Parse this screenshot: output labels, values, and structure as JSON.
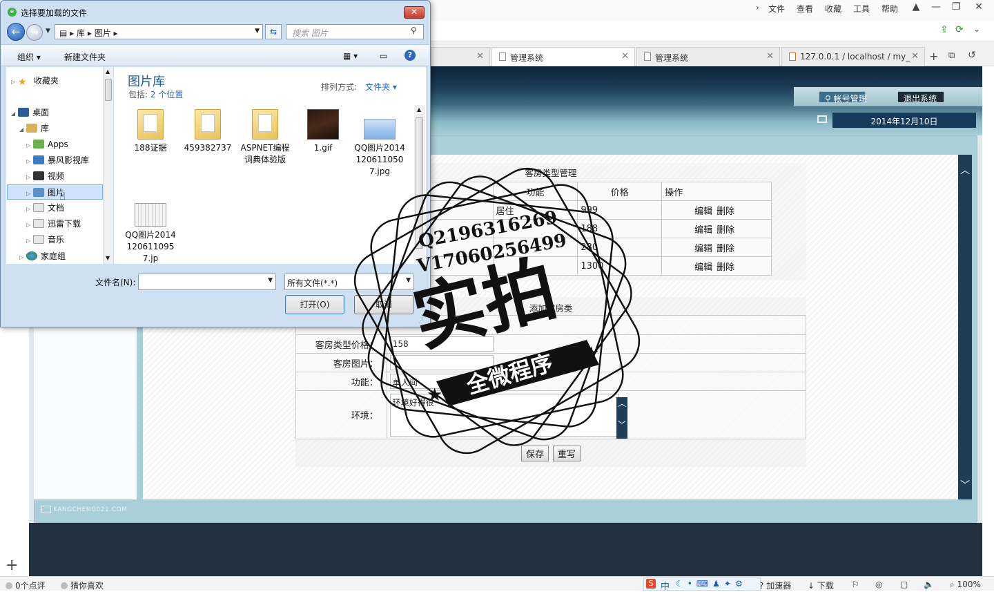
{
  "browser": {
    "menu": [
      "文件",
      "查看",
      "收藏",
      "工具",
      "帮助"
    ],
    "tabs": [
      {
        "label": ""
      },
      {
        "label": "管理系统"
      },
      {
        "label": "管理系统"
      },
      {
        "label": "127.0.0.1 / localhost / my_"
      }
    ],
    "status": {
      "comments": "0个点评",
      "recommend": "猜你喜欢",
      "accelerator": "加速器",
      "download": "下载",
      "zoom": "100%",
      "ime_mode": "中"
    }
  },
  "page": {
    "header": {
      "account_button": "帐号管理",
      "logout_button": "退出系统",
      "date": "2014年12月10日"
    },
    "room_types": {
      "title": "客房类型管理",
      "columns": [
        "",
        "功能",
        "价格",
        "操作"
      ],
      "rows": [
        {
          "name": "",
          "function": "居住",
          "price": "999"
        },
        {
          "name": "",
          "function": "",
          "price": "188"
        },
        {
          "name": "",
          "function": "",
          "price": "280"
        },
        {
          "name": "",
          "function": "",
          "price": "1300"
        }
      ],
      "edit_label": "编辑",
      "delete_label": "删除"
    },
    "form": {
      "title": "添加客房类",
      "price_label": "客房类型价格：",
      "price_value": "158",
      "image_label": "客房图片：",
      "function_label": "功能：",
      "function_value": "单人间",
      "environment_label": "环境：",
      "environment_value": "环境好得很",
      "save_button": "保存",
      "reset_button": "重写"
    },
    "footer_logo": "KANGCHENG021.COM"
  },
  "dialog": {
    "title": "选择要加载的文件",
    "path": [
      "库",
      "图片"
    ],
    "search_placeholder": "搜索 图片",
    "toolbar": {
      "organize": "组织",
      "new_folder": "新建文件夹"
    },
    "nav": [
      {
        "label": "收藏夹",
        "icon": "star-icon"
      },
      {
        "label": "桌面",
        "icon": "desktop-icon"
      },
      {
        "label": "库",
        "icon": "library-icon"
      },
      {
        "label": "Apps",
        "icon": "apps-icon"
      },
      {
        "label": "暴风影视库",
        "icon": "video-library-icon"
      },
      {
        "label": "视频",
        "icon": "video-icon"
      },
      {
        "label": "图片",
        "icon": "picture-icon"
      },
      {
        "label": "文档",
        "icon": "document-icon"
      },
      {
        "label": "迅雷下载",
        "icon": "download-icon"
      },
      {
        "label": "音乐",
        "icon": "music-icon"
      },
      {
        "label": "家庭组",
        "icon": "homegroup-icon"
      }
    ],
    "library_title": "图片库",
    "library_includes": "包括:",
    "library_locations": "2 个位置",
    "sort_label": "排列方式:",
    "sort_value": "文件夹",
    "files": [
      {
        "name": "188证据",
        "kind": "folder"
      },
      {
        "name": "459382737",
        "kind": "folder"
      },
      {
        "name": "ASPNET编程词典体验版",
        "kind": "folder"
      },
      {
        "name": "1.gif",
        "kind": "image"
      },
      {
        "name": "QQ图片20141206110507.jpg",
        "kind": "image"
      },
      {
        "name": "QQ图片20141206110957.jp",
        "kind": "image"
      }
    ],
    "filename_label": "文件名(N):",
    "filename_value": "",
    "filetype_value": "所有文件(*.*)",
    "open_button": "打开(O)",
    "cancel_button": "取消"
  },
  "watermark": {
    "line1": "Q2196316269",
    "line2": "V17060256499",
    "main": "实拍",
    "ribbon": "全微程序"
  },
  "colors": {
    "header_dark": "#0d2438",
    "frame": "#a9cfd8",
    "scrollbar": "#1e3d56",
    "dialog_bg": "#cfe0f2",
    "link_blue": "#2a6ac0"
  }
}
